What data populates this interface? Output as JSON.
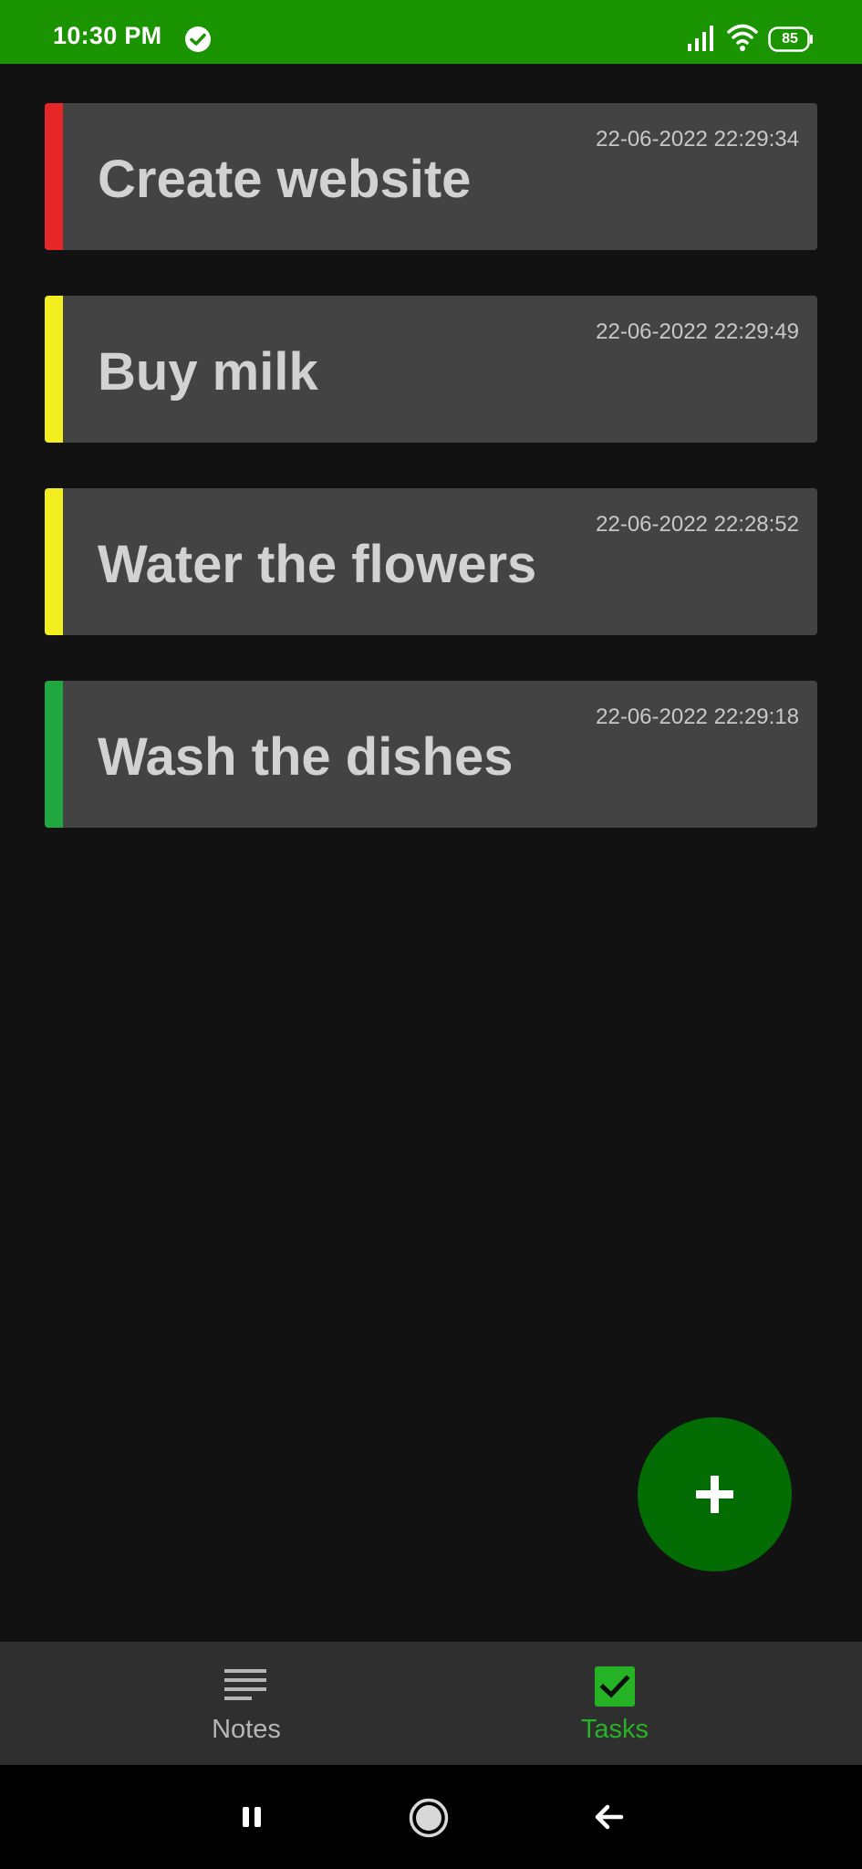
{
  "status_bar": {
    "time": "10:30 PM",
    "battery": "85",
    "icons": [
      "check-circle-icon",
      "signal-icon",
      "wifi-icon",
      "battery-icon"
    ],
    "background": "#1a9400"
  },
  "tasks": [
    {
      "title": "Create website",
      "timestamp": "22-06-2022 22:29:34",
      "priority_color": "#e52727"
    },
    {
      "title": "Buy milk",
      "timestamp": "22-06-2022 22:29:49",
      "priority_color": "#f2ee1f"
    },
    {
      "title": "Water the flowers",
      "timestamp": "22-06-2022 22:28:52",
      "priority_color": "#f2ee1f"
    },
    {
      "title": "Wash the dishes",
      "timestamp": "22-06-2022 22:29:18",
      "priority_color": "#1fa83f"
    }
  ],
  "fab": {
    "icon": "plus-icon",
    "color": "#036d03"
  },
  "bottom_nav": {
    "items": [
      {
        "label": "Notes",
        "icon": "notes-icon",
        "active": false
      },
      {
        "label": "Tasks",
        "icon": "tasks-check-icon",
        "active": true
      }
    ],
    "active_color": "#25b225"
  },
  "system_nav": {
    "icons": [
      "recents-icon",
      "home-icon",
      "back-icon"
    ]
  }
}
